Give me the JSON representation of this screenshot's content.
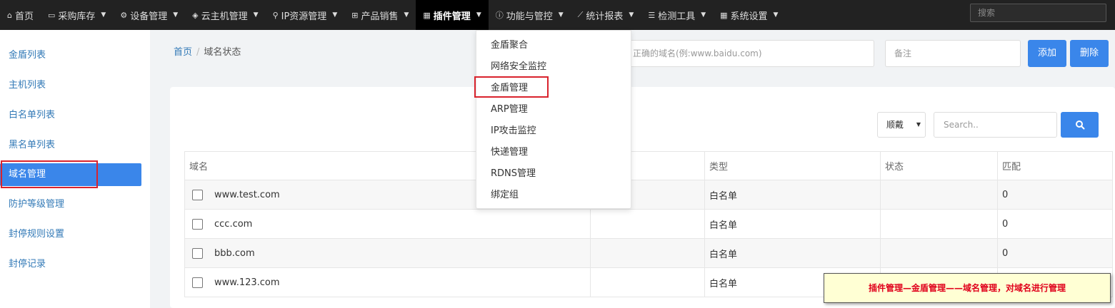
{
  "topnav": {
    "items": [
      {
        "label": "首页",
        "icon": "home-icon",
        "glyph": "⌂",
        "chevron": false
      },
      {
        "label": "采购库存",
        "icon": "hdd-icon",
        "glyph": "▭",
        "chevron": true
      },
      {
        "label": "设备管理",
        "icon": "cog-icon",
        "glyph": "⚙",
        "chevron": true
      },
      {
        "label": "云主机管理",
        "icon": "cube-icon",
        "glyph": "◈",
        "chevron": true
      },
      {
        "label": "IP资源管理",
        "icon": "map-marker-icon",
        "glyph": "⚲",
        "chevron": true
      },
      {
        "label": "产品销售",
        "icon": "shopping-cart-icon",
        "glyph": "⊞",
        "chevron": true
      },
      {
        "label": "插件管理",
        "icon": "th-icon",
        "glyph": "▦",
        "chevron": true
      },
      {
        "label": "功能与管控",
        "icon": "info-circle-icon",
        "glyph": "ⓘ",
        "chevron": true
      },
      {
        "label": "统计报表",
        "icon": "line-chart-icon",
        "glyph": "⟋",
        "chevron": true
      },
      {
        "label": "检测工具",
        "icon": "list-icon",
        "glyph": "☰",
        "chevron": true
      },
      {
        "label": "系统设置",
        "icon": "th-large-icon",
        "glyph": "▦",
        "chevron": true
      }
    ],
    "search_placeholder": "搜索"
  },
  "sidebar": {
    "items": [
      "金盾列表",
      "主机列表",
      "白名单列表",
      "黑名单列表",
      "域名管理",
      "防护等级管理",
      "封停规则设置",
      "封停记录"
    ]
  },
  "breadcrumb": {
    "home": "首页",
    "current": "域名状态"
  },
  "form": {
    "domain_placeholder": "请输入正确的域名(例:www.baidu.com)",
    "domain_visible": "正确的域名(例:www.baidu.com)",
    "remark_placeholder": "备注",
    "add_label": "添加",
    "delete_label": "删除"
  },
  "toolbar": {
    "sort_label": "顺戴",
    "search_placeholder": "Search.."
  },
  "table": {
    "headers": [
      "域名",
      "",
      "类型",
      "状态",
      "匹配"
    ],
    "rows": [
      {
        "domain": "www.test.com",
        "type": "白名单",
        "status": "",
        "match": "0"
      },
      {
        "domain": "ccc.com",
        "type": "白名单",
        "status": "",
        "match": "0"
      },
      {
        "domain": "bbb.com",
        "type": "白名单",
        "status": "",
        "match": "0"
      },
      {
        "domain": "www.123.com",
        "type": "白名单",
        "status": "",
        "match": ""
      }
    ]
  },
  "dropdown": {
    "items": [
      "金盾聚合",
      "网络安全监控",
      "金盾管理",
      "ARP管理",
      "IP攻击监控",
      "快递管理",
      "RDNS管理",
      "绑定组"
    ]
  },
  "annotation": {
    "text": "插件管理—金盾管理——域名管理，对域名进行管理",
    "color": "#e0001b"
  },
  "colors": {
    "accent": "#3a86ea",
    "highlight_border": "#d9232d",
    "nav_bg": "#222222"
  }
}
